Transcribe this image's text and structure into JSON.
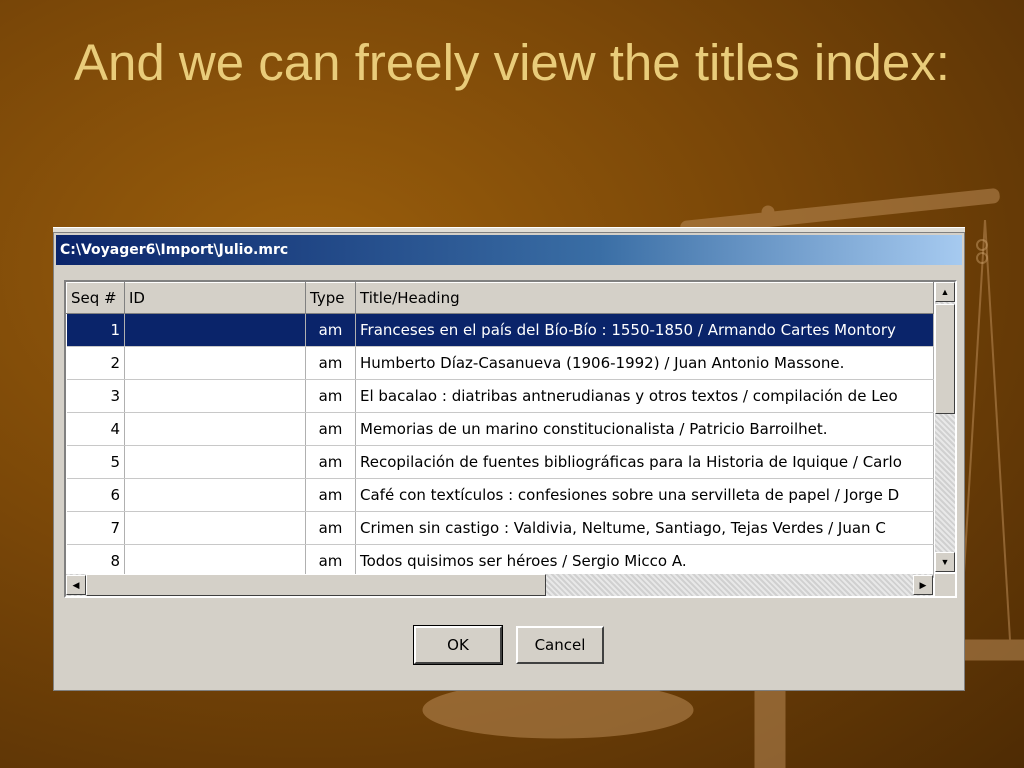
{
  "slide": {
    "title": "And we can freely view the titles index:"
  },
  "dialog": {
    "title": "C:\\Voyager6\\Import\\Julio.mrc",
    "columns": [
      "Seq #",
      "ID",
      "Type",
      "Title/Heading"
    ],
    "rows": [
      {
        "seq": "1",
        "id": "",
        "type": "am",
        "title": "Franceses en el país del Bío-Bío : 1550-1850 / Armando Cartes Montory",
        "selected": true
      },
      {
        "seq": "2",
        "id": "",
        "type": "am",
        "title": "Humberto Díaz-Casanueva (1906-1992) / Juan Antonio Massone.",
        "selected": false
      },
      {
        "seq": "3",
        "id": "",
        "type": "am",
        "title": "El bacalao : diatribas antnerudianas y otros textos / compilación de Leo",
        "selected": false
      },
      {
        "seq": "4",
        "id": "",
        "type": "am",
        "title": "Memorias de un marino constitucionalista / Patricio Barroilhet.",
        "selected": false
      },
      {
        "seq": "5",
        "id": "",
        "type": "am",
        "title": "Recopilación de fuentes bibliográficas para la Historia de Iquique / Carlo",
        "selected": false
      },
      {
        "seq": "6",
        "id": "",
        "type": "am",
        "title": "Café con textículos : confesiones sobre una servilleta de papel / Jorge D",
        "selected": false
      },
      {
        "seq": "7",
        "id": "",
        "type": "am",
        "title": "Crimen sin castigo : Valdivia, Neltume, Santiago, Tejas Verdes / Juan C",
        "selected": false
      },
      {
        "seq": "8",
        "id": "",
        "type": "am",
        "title": "Todos quisimos ser héroes / Sergio Micco A.",
        "selected": false
      }
    ],
    "ok_label": "OK",
    "cancel_label": "Cancel"
  },
  "colors": {
    "background": "#7a4708",
    "title_text": "#e9cc7a",
    "selection": "#0a246a"
  }
}
